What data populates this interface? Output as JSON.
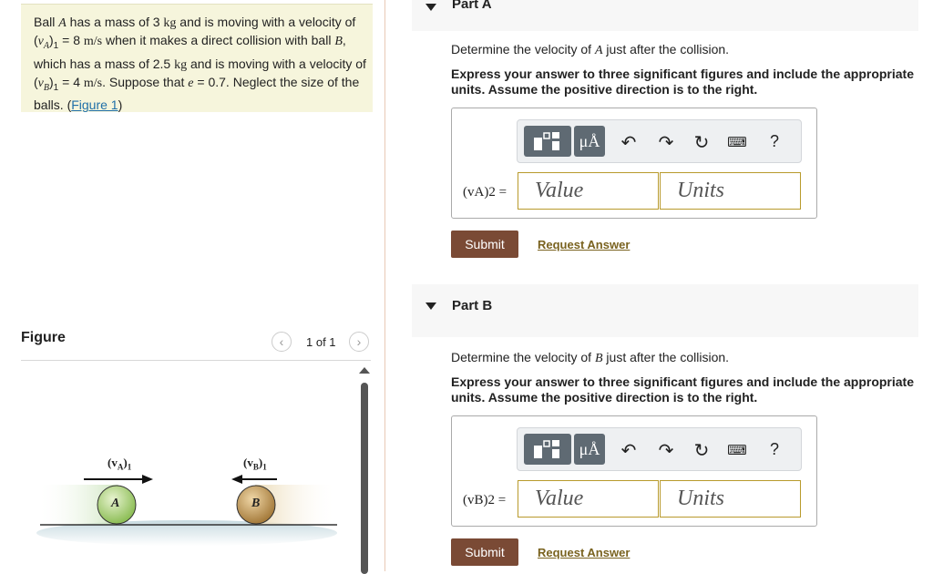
{
  "problem": {
    "segments": [
      "Ball ",
      "A",
      " has a mass of 3 ",
      "kg",
      " and is moving with a velocity of (",
      "v",
      "A",
      ")",
      "1",
      " = 8 ",
      "m/s",
      " when it makes a direct collision with ball ",
      "B",
      ", which has a mass of 2.5 ",
      "kg",
      " and is moving with a velocity of (",
      "v",
      "B",
      ")",
      "1",
      " = 4 ",
      "m/s",
      ". Suppose that ",
      "e",
      " = 0.7. Neglect the size of the balls. ("
    ],
    "link": "Figure 1",
    "close": ")"
  },
  "figure": {
    "title": "Figure",
    "counter": "1 of 1",
    "prev_icon": "chevron-left-icon",
    "next_icon": "chevron-right-icon",
    "label_va": "(v",
    "label_va_sub": "A",
    "label_va_sub2": "1",
    "label_vb": "(v",
    "label_vb_sub": "B",
    "label_vb_sub2": "1",
    "ball_a": "A",
    "ball_b": "B"
  },
  "partA": {
    "title": "Part A",
    "question_pre": "Determine the velocity of ",
    "question_var": "A",
    "question_post": " just after the collision.",
    "instruction": "Express your answer to three significant figures and include the appropriate units. Assume the positive direction is to the right.",
    "label": "(vA)2 =",
    "value_placeholder": "Value",
    "units_placeholder": "Units",
    "submit": "Submit",
    "request": "Request Answer"
  },
  "partB": {
    "title": "Part B",
    "question_pre": "Determine the velocity of ",
    "question_var": "B",
    "question_post": " just after the collision.",
    "instruction": "Express your answer to three significant figures and include the appropriate units. Assume the positive direction is to the right.",
    "label": "(vB)2 =",
    "value_placeholder": "Value",
    "units_placeholder": "Units",
    "submit": "Submit",
    "request": "Request Answer"
  },
  "toolbar": {
    "mu_label": "μÅ",
    "help_label": "?",
    "icons": [
      "templates-icon",
      "symbols-icon",
      "undo-icon",
      "redo-icon",
      "reset-icon",
      "keyboard-icon",
      "help-icon"
    ]
  },
  "colors": {
    "submit_bg": "#7a4a35",
    "field_border": "#b89a2c",
    "link": "#1f6fa8",
    "problem_bg": "#f6f5dc"
  }
}
